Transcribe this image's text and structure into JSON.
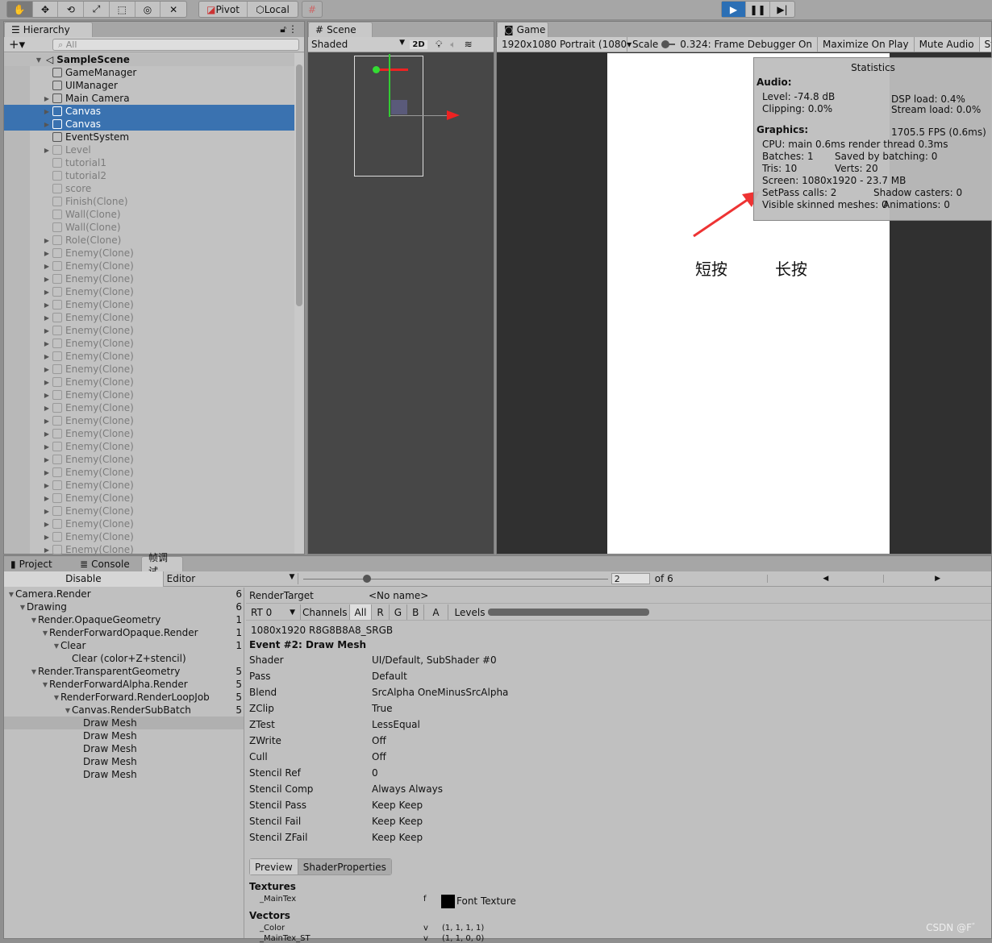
{
  "toolbar": {
    "tools": [
      "hand-tool",
      "move-tool",
      "rotate-tool",
      "scale-tool",
      "rect-tool",
      "transform-tool",
      "custom-tool"
    ],
    "pivot": "Pivot",
    "local": "Local",
    "play_color": "#2b6fb5"
  },
  "hierarchy": {
    "tab": "Hierarchy",
    "search_placeholder": "All",
    "scene": "SampleScene",
    "items": [
      {
        "label": "GameManager",
        "arrow": false,
        "dim": false,
        "sel": false
      },
      {
        "label": "UIManager",
        "arrow": false,
        "dim": false,
        "sel": false
      },
      {
        "label": "Main Camera",
        "arrow": true,
        "dim": false,
        "sel": false
      },
      {
        "label": "Canvas",
        "arrow": true,
        "dim": false,
        "sel": true
      },
      {
        "label": "Canvas",
        "arrow": true,
        "dim": false,
        "sel": true
      },
      {
        "label": "EventSystem",
        "arrow": false,
        "dim": false,
        "sel": false
      },
      {
        "label": "Level",
        "arrow": true,
        "dim": true,
        "sel": false
      },
      {
        "label": "tutorial1",
        "arrow": false,
        "dim": true,
        "sel": false
      },
      {
        "label": "tutorial2",
        "arrow": false,
        "dim": true,
        "sel": false
      },
      {
        "label": "score",
        "arrow": false,
        "dim": true,
        "sel": false
      },
      {
        "label": "Finish(Clone)",
        "arrow": false,
        "dim": true,
        "sel": false
      },
      {
        "label": "Wall(Clone)",
        "arrow": false,
        "dim": true,
        "sel": false
      },
      {
        "label": "Wall(Clone)",
        "arrow": false,
        "dim": true,
        "sel": false
      },
      {
        "label": "Role(Clone)",
        "arrow": true,
        "dim": true,
        "sel": false
      },
      {
        "label": "Enemy(Clone)",
        "arrow": true,
        "dim": true,
        "sel": false
      },
      {
        "label": "Enemy(Clone)",
        "arrow": true,
        "dim": true,
        "sel": false
      },
      {
        "label": "Enemy(Clone)",
        "arrow": true,
        "dim": true,
        "sel": false
      },
      {
        "label": "Enemy(Clone)",
        "arrow": true,
        "dim": true,
        "sel": false
      },
      {
        "label": "Enemy(Clone)",
        "arrow": true,
        "dim": true,
        "sel": false
      },
      {
        "label": "Enemy(Clone)",
        "arrow": true,
        "dim": true,
        "sel": false
      },
      {
        "label": "Enemy(Clone)",
        "arrow": true,
        "dim": true,
        "sel": false
      },
      {
        "label": "Enemy(Clone)",
        "arrow": true,
        "dim": true,
        "sel": false
      },
      {
        "label": "Enemy(Clone)",
        "arrow": true,
        "dim": true,
        "sel": false
      },
      {
        "label": "Enemy(Clone)",
        "arrow": true,
        "dim": true,
        "sel": false
      },
      {
        "label": "Enemy(Clone)",
        "arrow": true,
        "dim": true,
        "sel": false
      },
      {
        "label": "Enemy(Clone)",
        "arrow": true,
        "dim": true,
        "sel": false
      },
      {
        "label": "Enemy(Clone)",
        "arrow": true,
        "dim": true,
        "sel": false
      },
      {
        "label": "Enemy(Clone)",
        "arrow": true,
        "dim": true,
        "sel": false
      },
      {
        "label": "Enemy(Clone)",
        "arrow": true,
        "dim": true,
        "sel": false
      },
      {
        "label": "Enemy(Clone)",
        "arrow": true,
        "dim": true,
        "sel": false
      },
      {
        "label": "Enemy(Clone)",
        "arrow": true,
        "dim": true,
        "sel": false
      },
      {
        "label": "Enemy(Clone)",
        "arrow": true,
        "dim": true,
        "sel": false
      },
      {
        "label": "Enemy(Clone)",
        "arrow": true,
        "dim": true,
        "sel": false
      },
      {
        "label": "Enemy(Clone)",
        "arrow": true,
        "dim": true,
        "sel": false
      },
      {
        "label": "Enemy(Clone)",
        "arrow": true,
        "dim": true,
        "sel": false
      },
      {
        "label": "Enemy(Clone)",
        "arrow": true,
        "dim": true,
        "sel": false
      },
      {
        "label": "Enemy(Clone)",
        "arrow": true,
        "dim": true,
        "sel": false
      },
      {
        "label": "Enemy(Clone)",
        "arrow": true,
        "dim": true,
        "sel": false
      }
    ]
  },
  "scene": {
    "tab": "Scene",
    "shading": "Shaded",
    "mode_2d": "2D"
  },
  "game": {
    "tab": "Game",
    "resolution": "1920x1080 Portrait (1080",
    "scale_label": "Scale",
    "scale_value": "0.324:",
    "frame_debugger": "Frame Debugger On",
    "maximize": "Maximize On Play",
    "mute": "Mute Audio",
    "stats": "Stats",
    "labels": [
      "短按",
      "长按"
    ],
    "statistics": {
      "title": "Statistics",
      "audio_h": "Audio:",
      "level": "Level: -74.8 dB",
      "clipping": "Clipping: 0.0%",
      "dsp": "DSP load: 0.4%",
      "stream": "Stream load: 0.0%",
      "graphics_h": "Graphics:",
      "fps": "1705.5 FPS (0.6ms)",
      "cpu": "CPU: main 0.6ms  render thread 0.3ms",
      "batches": "Batches: 1",
      "saved": "Saved by batching: 0",
      "tris": "Tris: 10",
      "verts": "Verts: 20",
      "screen": "Screen: 1080x1920 - 23.7 MB",
      "setpass": "SetPass calls: 2",
      "shadow": "Shadow casters: 0",
      "skinned": "Visible skinned meshes: 0",
      "animations": "Animations: 0"
    }
  },
  "bottom": {
    "tabs": [
      "Project",
      "Console",
      "帧调试"
    ],
    "disable": "Disable",
    "target": "Editor",
    "event_index": "2",
    "of_total": "of 6",
    "tree": [
      {
        "label": "Camera.Render",
        "level": 0,
        "arrow": true,
        "count": "6"
      },
      {
        "label": "Drawing",
        "level": 1,
        "arrow": true,
        "count": "6"
      },
      {
        "label": "Render.OpaqueGeometry",
        "level": 2,
        "arrow": true,
        "count": "1"
      },
      {
        "label": "RenderForwardOpaque.Render",
        "level": 3,
        "arrow": true,
        "count": "1"
      },
      {
        "label": "Clear",
        "level": 4,
        "arrow": true,
        "count": "1"
      },
      {
        "label": "Clear (color+Z+stencil)",
        "level": 5,
        "arrow": false,
        "count": ""
      },
      {
        "label": "Render.TransparentGeometry",
        "level": 2,
        "arrow": true,
        "count": "5"
      },
      {
        "label": "RenderForwardAlpha.Render",
        "level": 3,
        "arrow": true,
        "count": "5"
      },
      {
        "label": "RenderForward.RenderLoopJob",
        "level": 4,
        "arrow": true,
        "count": "5"
      },
      {
        "label": "Canvas.RenderSubBatch",
        "level": 5,
        "arrow": true,
        "count": "5"
      },
      {
        "label": "Draw Mesh",
        "level": 6,
        "arrow": false,
        "count": "",
        "sel": true
      },
      {
        "label": "Draw Mesh",
        "level": 6,
        "arrow": false,
        "count": ""
      },
      {
        "label": "Draw Mesh",
        "level": 6,
        "arrow": false,
        "count": ""
      },
      {
        "label": "Draw Mesh",
        "level": 6,
        "arrow": false,
        "count": ""
      },
      {
        "label": "Draw Mesh",
        "level": 6,
        "arrow": false,
        "count": ""
      }
    ],
    "render_target_label": "RenderTarget",
    "render_target": "<No name>",
    "rt": "RT 0",
    "channels": "Channels",
    "channel_opts": [
      "All",
      "R",
      "G",
      "B",
      "A"
    ],
    "levels": "Levels",
    "format": "1080x1920 R8G8B8A8_SRGB",
    "event_title": "Event #2: Draw Mesh",
    "props": [
      [
        "Shader",
        "UI/Default, SubShader #0"
      ],
      [
        "Pass",
        "Default"
      ],
      [
        "Blend",
        "SrcAlpha OneMinusSrcAlpha"
      ],
      [
        "ZClip",
        "True"
      ],
      [
        "ZTest",
        "LessEqual"
      ],
      [
        "ZWrite",
        "Off"
      ],
      [
        "Cull",
        "Off"
      ],
      [
        "Stencil Ref",
        "0"
      ],
      [
        "Stencil Comp",
        "Always Always"
      ],
      [
        "Stencil Pass",
        "Keep Keep"
      ],
      [
        "Stencil Fail",
        "Keep Keep"
      ],
      [
        "Stencil ZFail",
        "Keep Keep"
      ]
    ],
    "preview_tab": "Preview",
    "shaderprops_tab": "ShaderProperties",
    "textures_h": "Textures",
    "maintex": "_MainTex",
    "maintex_type": "f",
    "maintex_val": "Font Texture",
    "vectors_h": "Vectors",
    "color": "_Color",
    "color_type": "v",
    "color_val": "(1, 1, 1, 1)",
    "maintex_st": "_MainTex_ST",
    "st_type": "v",
    "st_val": "(1, 1, 0, 0)"
  },
  "watermark": "CSDN @F゛"
}
